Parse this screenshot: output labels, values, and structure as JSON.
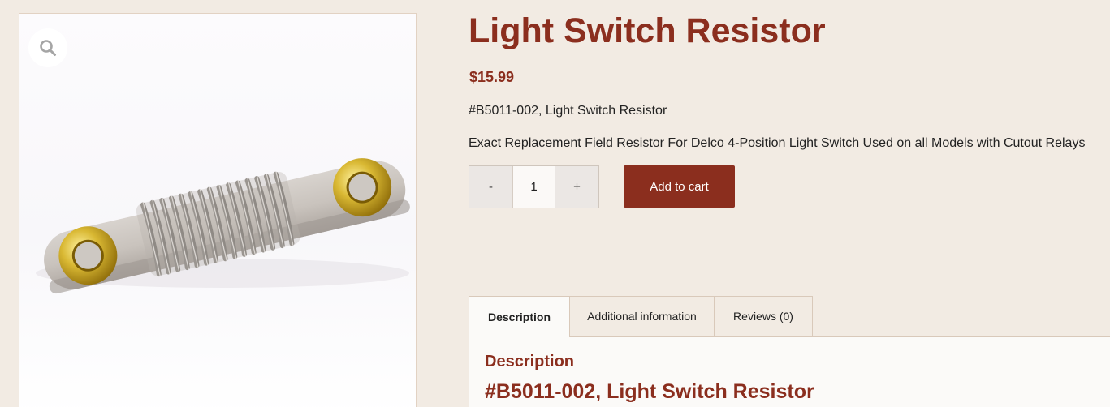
{
  "gallery": {
    "zoom_icon": "magnifier-icon",
    "image_alt": "Light Switch Resistor"
  },
  "product": {
    "title": "Light Switch Resistor",
    "price": "$15.99",
    "short_line_1": "#B5011-002, Light Switch Resistor",
    "short_line_2": "Exact Replacement Field Resistor For Delco 4-Position Light Switch Used on all Models with Cutout Relays"
  },
  "cart": {
    "minus_label": "-",
    "quantity": "1",
    "plus_label": "+",
    "add_to_cart_label": "Add to cart"
  },
  "tabs": {
    "items": [
      {
        "label": "Description"
      },
      {
        "label": "Additional information"
      },
      {
        "label": "Reviews (0)"
      }
    ],
    "active_index": 0
  },
  "panel": {
    "heading": "Description",
    "subheading": "#B5011-002, Light Switch Resistor"
  },
  "colors": {
    "background": "#f2ebe3",
    "accent": "#8b2e1e",
    "button_text": "#ffffff"
  }
}
